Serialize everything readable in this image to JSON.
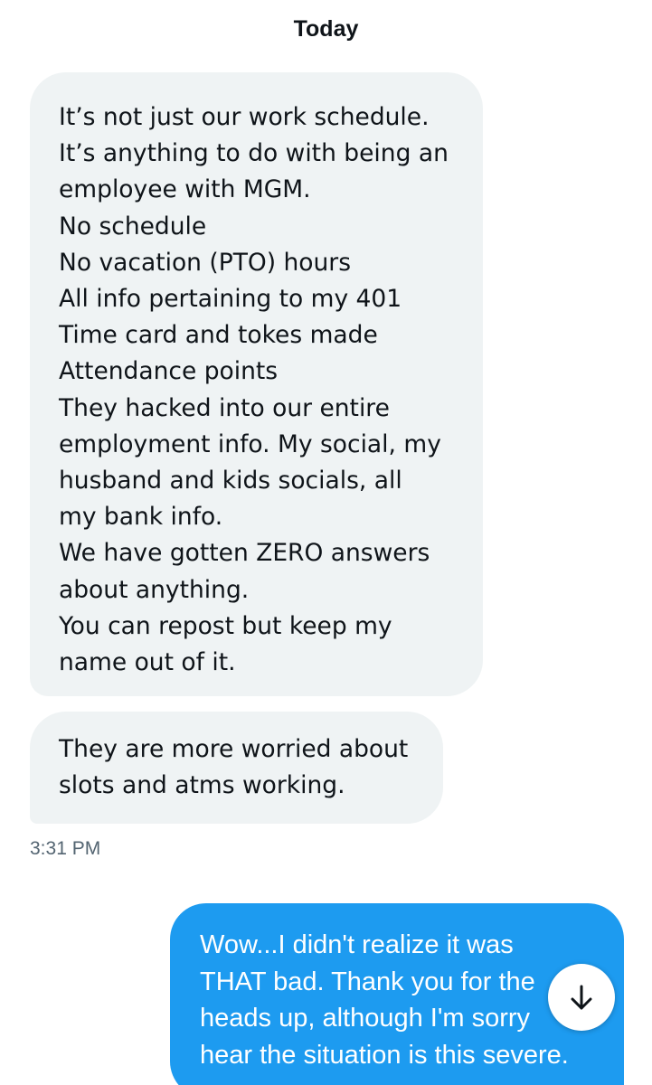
{
  "conversation": {
    "date_header": "Today",
    "messages": [
      {
        "direction": "incoming",
        "lines": [
          "It’s not just our work schedule.",
          "It’s anything to do with being an",
          "employee with MGM.",
          "No schedule",
          "No vacation (PTO) hours",
          "All info pertaining to my 401",
          "Time card and tokes made",
          "Attendance points",
          "They hacked into our entire",
          "employment info. My social, my",
          "husband and kids socials, all",
          "my bank info.",
          "We have gotten ZERO answers",
          "about anything.",
          "You can repost but keep my",
          "name out of it."
        ]
      },
      {
        "direction": "incoming",
        "lines": [
          "They are more worried about",
          "slots and atms working."
        ]
      },
      {
        "direction": "outgoing",
        "lines": [
          "Wow...I didn't realize it was",
          "THAT bad. Thank you for the",
          "heads up, although I'm sorry",
          "hear the situation is this severe."
        ]
      }
    ],
    "timestamp": "3:31 PM",
    "scroll_button_icon": "arrow-down-icon",
    "colors": {
      "incoming_bubble": "#eff3f4",
      "outgoing_bubble": "#1d9bf0",
      "text": "#0f1419",
      "timestamp": "#536471"
    }
  }
}
